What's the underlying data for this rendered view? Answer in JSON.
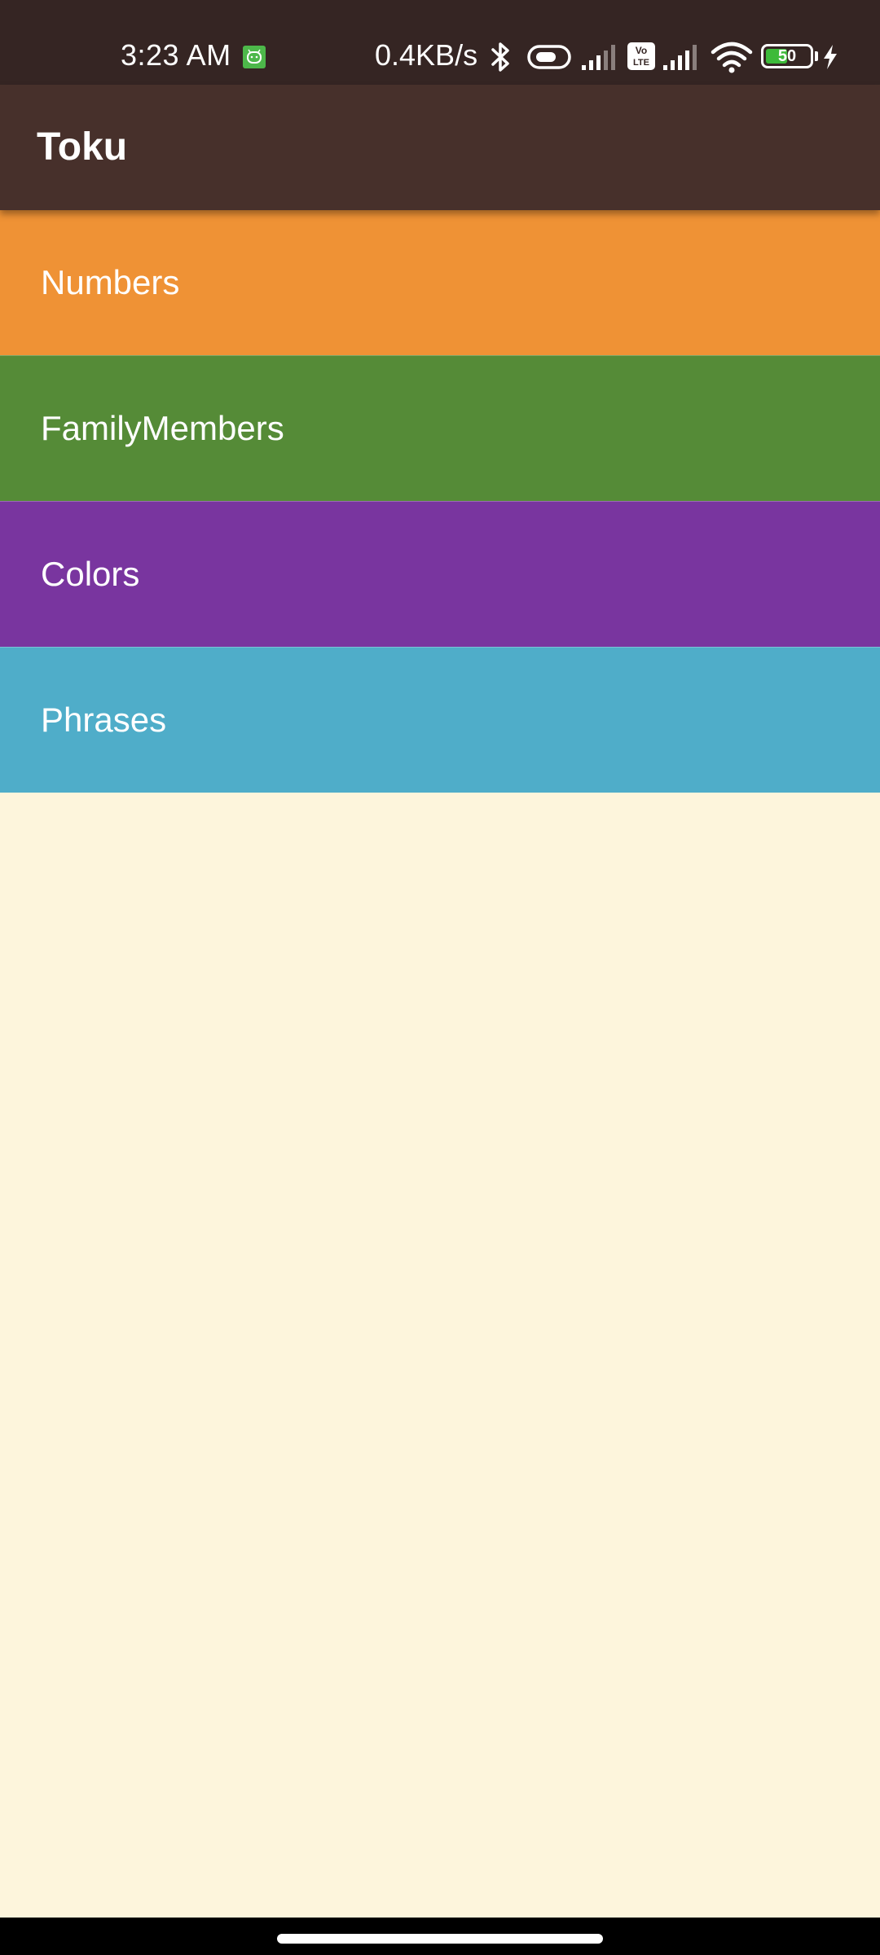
{
  "status_bar": {
    "time": "3:23 AM",
    "network_speed": "0.4KB/s",
    "battery_level": "50",
    "battery_fraction": 0.5,
    "charging": true,
    "icons": [
      "notification-app-icon",
      "bluetooth-icon",
      "toggle-icon",
      "signal-strength-icon",
      "volte-icon",
      "signal-strength-icon",
      "wifi-icon",
      "battery-icon",
      "charging-bolt-icon"
    ]
  },
  "app_bar": {
    "title": "Toku"
  },
  "categories": [
    {
      "label": "Numbers",
      "color": "#EF9235"
    },
    {
      "label": "FamilyMembers",
      "color": "#558B37"
    },
    {
      "label": "Colors",
      "color": "#79359F"
    },
    {
      "label": "Phrases",
      "color": "#4FADC9"
    }
  ],
  "colors": {
    "status_bar": "#352523",
    "app_bar": "#47302B",
    "background": "#FDF5DC",
    "nav_bar": "#000000"
  }
}
